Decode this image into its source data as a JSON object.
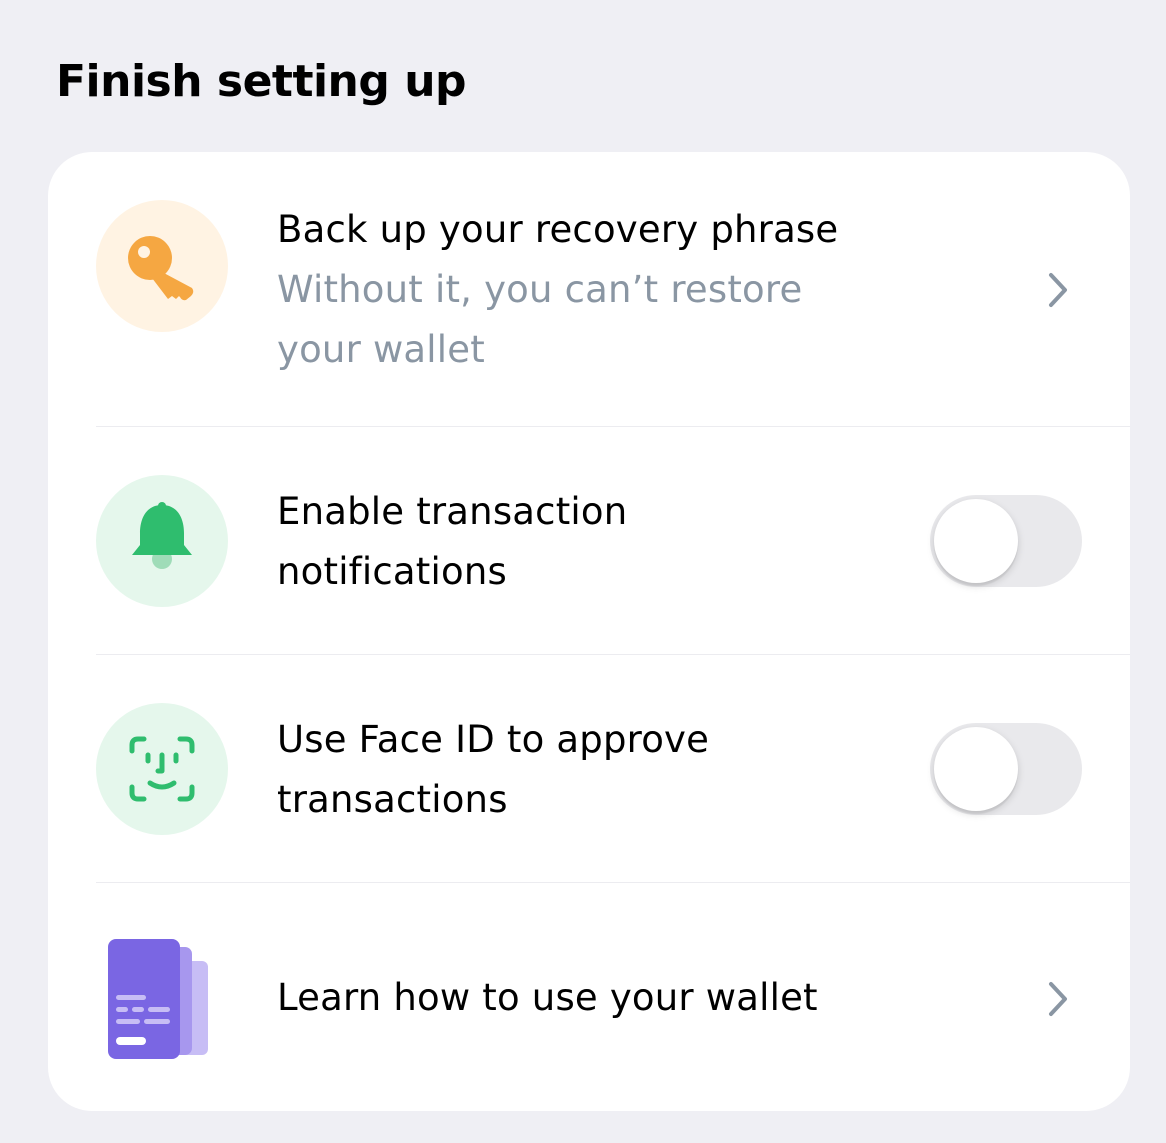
{
  "header": {
    "title": "Finish setting up"
  },
  "items": [
    {
      "title": "Back up your recovery phrase",
      "subtitle_line1": "Without it, you can’t restore",
      "subtitle_line2": "your wallet",
      "icon": "key-icon",
      "control": "chevron"
    },
    {
      "title_line1": "Enable transaction",
      "title_line2": "notifications",
      "icon": "bell-icon",
      "control": "toggle",
      "toggle_on": false
    },
    {
      "title_line1": "Use Face ID to approve",
      "title_line2": "transactions",
      "icon": "face-id-icon",
      "control": "toggle",
      "toggle_on": false
    },
    {
      "title": "Learn how to use your wallet",
      "icon": "guide-cards-icon",
      "control": "chevron"
    }
  ],
  "colors": {
    "background": "#efeff4",
    "card": "#ffffff",
    "key_accent": "#f5a742",
    "key_bg": "#fff3e3",
    "green_accent": "#2fbd6e",
    "green_bg": "#e5f7ec",
    "purple_accent": "#7a66e3",
    "subtitle_gray": "#8a96a3",
    "toggle_off": "#e9e9ec"
  }
}
